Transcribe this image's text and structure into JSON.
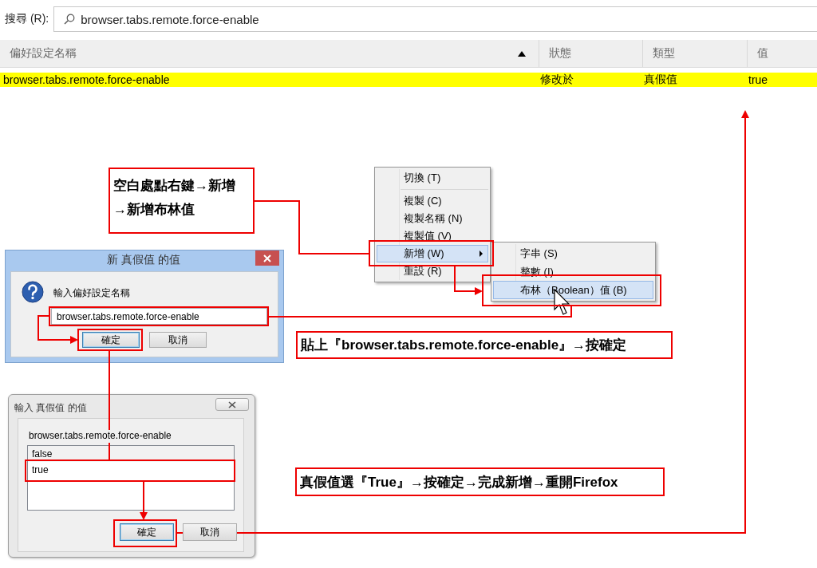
{
  "search": {
    "label": "搜尋 (R):",
    "value": "browser.tabs.remote.force-enable"
  },
  "table": {
    "columns": [
      {
        "label": "偏好設定名稱",
        "sorted": true
      },
      {
        "label": "狀態",
        "sorted": false
      },
      {
        "label": "類型",
        "sorted": false
      },
      {
        "label": "值",
        "sorted": false
      }
    ],
    "rows": [
      {
        "name": "browser.tabs.remote.force-enable",
        "status": "修改於",
        "type": "真假值",
        "value": "true",
        "highlighted": true
      }
    ]
  },
  "context_menu": {
    "items": [
      {
        "kind": "item",
        "label": "切換 (T)",
        "selected": false,
        "submenu": false
      },
      {
        "kind": "separator"
      },
      {
        "kind": "item",
        "label": "複製 (C)",
        "selected": false,
        "submenu": false
      },
      {
        "kind": "item",
        "label": "複製名稱 (N)",
        "selected": false,
        "submenu": false
      },
      {
        "kind": "item",
        "label": "複製值 (V)",
        "selected": false,
        "submenu": false
      },
      {
        "kind": "item",
        "label": "新增 (W)",
        "selected": true,
        "submenu": true
      },
      {
        "kind": "item",
        "label": "重設 (R)",
        "selected": false,
        "submenu": false
      }
    ],
    "submenu": [
      {
        "label": "字串 (S)",
        "selected": false
      },
      {
        "label": "整數 (I)",
        "selected": false
      },
      {
        "label": "布林（Boolean）值 (B)",
        "selected": true
      }
    ]
  },
  "name_dialog": {
    "title": "新 真假值 的值",
    "prompt": "輸入偏好設定名稱",
    "value": "browser.tabs.remote.force-enable",
    "buttons": [
      {
        "label": "確定",
        "focused": true
      },
      {
        "label": "取消",
        "focused": false
      }
    ]
  },
  "value_dialog": {
    "title": "輸入 真假值 的值",
    "prompt": "browser.tabs.remote.force-enable",
    "options": [
      {
        "label": "false",
        "selected": false
      },
      {
        "label": "true",
        "selected": false
      }
    ],
    "buttons": [
      {
        "label": "確定",
        "focused": true
      },
      {
        "label": "取消",
        "focused": false
      }
    ]
  },
  "notes": [
    {
      "text": "空白處點右鍵→新增\n→新增布林值"
    },
    {
      "text": "貼上『browser.tabs.remote.force-enable』→按確定"
    },
    {
      "text": "真假值選『True』→按確定→完成新增→重開Firefox"
    }
  ]
}
